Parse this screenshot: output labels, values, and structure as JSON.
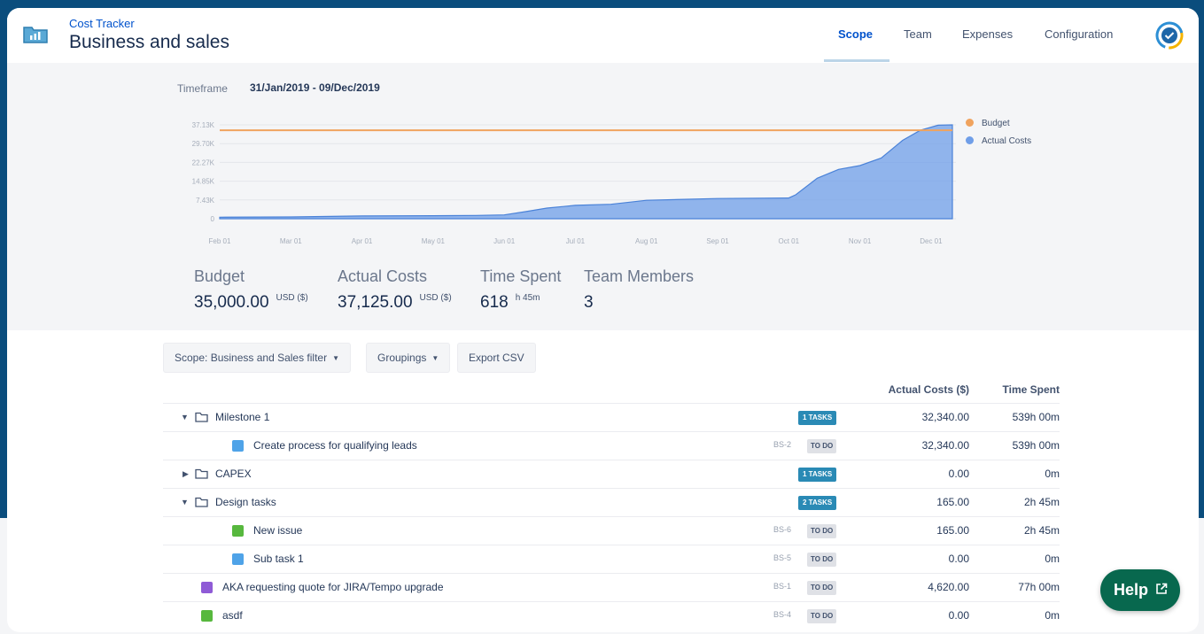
{
  "header": {
    "subtitle": "Cost Tracker",
    "title": "Business and sales",
    "tabs": [
      {
        "label": "Scope",
        "active": true
      },
      {
        "label": "Team",
        "active": false
      },
      {
        "label": "Expenses",
        "active": false
      },
      {
        "label": "Configuration",
        "active": false
      }
    ]
  },
  "timeframe": {
    "label": "Timeframe",
    "value": "31/Jan/2019 - 09/Dec/2019"
  },
  "chart_data": {
    "type": "area",
    "x_labels": [
      "Feb 01",
      "Mar 01",
      "Apr 01",
      "May 01",
      "Jun 01",
      "Jul 01",
      "Aug 01",
      "Sep 01",
      "Oct 01",
      "Nov 01",
      "Dec 01"
    ],
    "y_ticks": [
      "37.13K",
      "29.70K",
      "22.27K",
      "14.85K",
      "7.43K",
      "0"
    ],
    "ylim": [
      0,
      37125
    ],
    "series": [
      {
        "name": "Budget",
        "type": "line",
        "color": "#f0a35e",
        "values": [
          35000,
          35000
        ]
      },
      {
        "name": "Actual Costs",
        "type": "area",
        "color": "#6f9ee8",
        "x": [
          0,
          1.0,
          2.0,
          3.0,
          3.6,
          4.0,
          4.3,
          4.6,
          5.0,
          5.5,
          6.0,
          7.0,
          8.0,
          8.1,
          8.4,
          8.7,
          9.0,
          9.3,
          9.6,
          9.85,
          10.1,
          10.3
        ],
        "values": [
          600,
          700,
          1100,
          1200,
          1300,
          1500,
          2800,
          4200,
          5300,
          5700,
          7300,
          8000,
          8200,
          9500,
          16000,
          19500,
          21000,
          24000,
          31000,
          35000,
          37000,
          37125
        ]
      }
    ]
  },
  "legend": [
    "Budget",
    "Actual Costs"
  ],
  "stats": [
    {
      "label": "Budget",
      "value": "35,000.00",
      "unit": "USD ($)"
    },
    {
      "label": "Actual Costs",
      "value": "37,125.00",
      "unit": "USD ($)"
    },
    {
      "label": "Time Spent",
      "value": "618",
      "unit": "h 45m"
    },
    {
      "label": "Team Members",
      "value": "3",
      "unit": ""
    }
  ],
  "toolbar": {
    "scope_filter": "Scope: Business and Sales filter",
    "groupings": "Groupings",
    "export": "Export CSV"
  },
  "table": {
    "headers": {
      "actual_costs": "Actual Costs ($)",
      "time_spent": "Time Spent"
    },
    "rows": [
      {
        "type": "group",
        "expanded": true,
        "name": "Milestone 1",
        "badge": "1 TASKS",
        "cost": "32,340.00",
        "time": "539h 00m"
      },
      {
        "type": "task",
        "icon": "task-icon",
        "name": "Create process for qualifying leads",
        "key": "BS-2",
        "status": "TO DO",
        "cost": "32,340.00",
        "time": "539h 00m"
      },
      {
        "type": "group",
        "expanded": false,
        "name": "CAPEX",
        "badge": "1 TASKS",
        "cost": "0.00",
        "time": "0m"
      },
      {
        "type": "group",
        "expanded": true,
        "name": "Design tasks",
        "badge": "2 TASKS",
        "cost": "165.00",
        "time": "2h 45m"
      },
      {
        "type": "task",
        "icon": "story-icon",
        "name": "New issue",
        "key": "BS-6",
        "status": "TO DO",
        "cost": "165.00",
        "time": "2h 45m"
      },
      {
        "type": "task",
        "icon": "subtask-icon",
        "name": "Sub task 1",
        "key": "BS-5",
        "status": "TO DO",
        "cost": "0.00",
        "time": "0m"
      },
      {
        "type": "task-root",
        "icon": "epic-icon",
        "name": "AKA requesting quote for JIRA/Tempo upgrade",
        "key": "BS-1",
        "status": "TO DO",
        "cost": "4,620.00",
        "time": "77h 00m"
      },
      {
        "type": "task-root",
        "icon": "story-icon",
        "name": "asdf",
        "key": "BS-4",
        "status": "TO DO",
        "cost": "0.00",
        "time": "0m"
      }
    ]
  },
  "help": {
    "label": "Help"
  }
}
